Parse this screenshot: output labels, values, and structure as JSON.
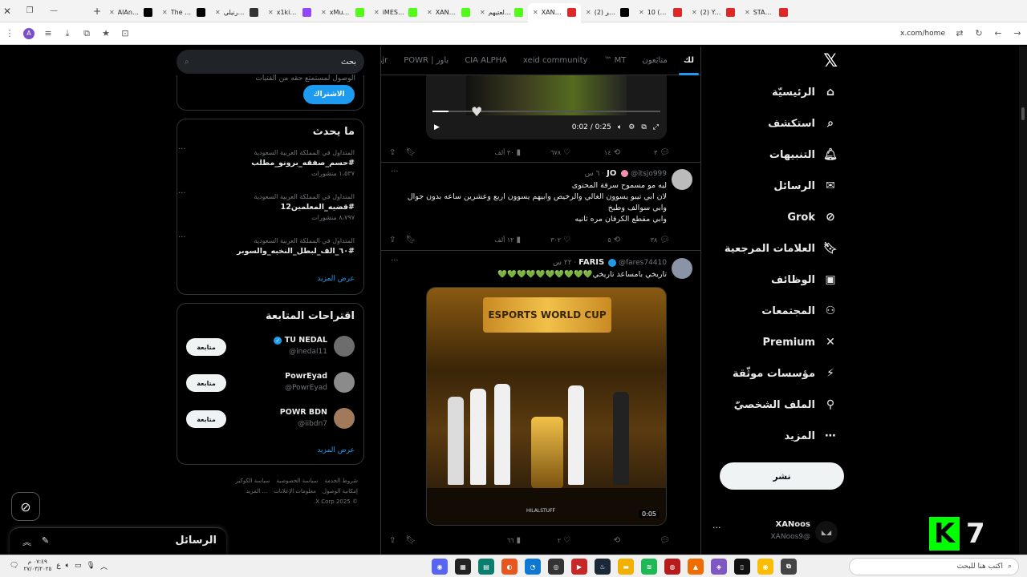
{
  "browser": {
    "tabs": [
      {
        "title": "AlAnzi (@",
        "color": "#000000",
        "icon": "x-icon"
      },
      {
        "title": "The best ",
        "color": "#000000",
        "icon": "tiktok-icon"
      },
      {
        "title": "تورنيلي -",
        "color": "#333333",
        "icon": "github-icon"
      },
      {
        "title": "x1kid Stre",
        "color": "#9146ff",
        "icon": "twitch-icon"
      },
      {
        "title": "xMusaad",
        "color": "#53fc18",
        "icon": "kick-icon"
      },
      {
        "title": "iMESO Str",
        "color": "#53fc18",
        "icon": "kick-icon"
      },
      {
        "title": "XANoos",
        "color": "#53fc18",
        "icon": "kick-icon"
      },
      {
        "title": "لعتيهم | pp",
        "color": "#53fc18",
        "icon": "kick-icon"
      },
      {
        "title": "XANoos (",
        "color": "#e02727",
        "icon": "youtube-icon",
        "active": true
      },
      {
        "title": "(2) لأول مر",
        "color": "#000000",
        "icon": "x-icon"
      },
      {
        "title": "10 (2) دقا",
        "color": "#e02727",
        "icon": "youtube-icon"
      },
      {
        "title": "(2) YouTub",
        "color": "#e02727",
        "icon": "youtube-icon"
      },
      {
        "title": "STARDOM",
        "color": "#e02727",
        "icon": "youtube-icon"
      }
    ],
    "url": "x.com/home",
    "profile_letter": "A"
  },
  "nav": {
    "items": [
      {
        "label": "الرئيسيّة",
        "icon": "⌂",
        "name": "home"
      },
      {
        "label": "استكشف",
        "icon": "⌕",
        "name": "explore"
      },
      {
        "label": "التنبيهات",
        "icon": "🔔︎",
        "name": "notifications"
      },
      {
        "label": "الرسائل",
        "icon": "✉",
        "name": "messages"
      },
      {
        "label": "Grok",
        "icon": "⊘",
        "name": "grok"
      },
      {
        "label": "العلامات المرجعية",
        "icon": "🔖︎",
        "name": "bookmarks"
      },
      {
        "label": "الوظائف",
        "icon": "▣",
        "name": "jobs"
      },
      {
        "label": "المجتمعات",
        "icon": "⚇",
        "name": "communities"
      },
      {
        "label": "Premium",
        "icon": "✕",
        "name": "premium"
      },
      {
        "label": "مؤسسات موثّقة",
        "icon": "⚡",
        "name": "verified-orgs"
      },
      {
        "label": "الملف الشخصيّ",
        "icon": "⚲",
        "name": "profile"
      },
      {
        "label": "المزيد",
        "icon": "⋯",
        "name": "more"
      }
    ],
    "post_label": "نشر",
    "me_name": "XANoos",
    "me_handle": "@XANoos9"
  },
  "overlay": {
    "badge_number": "7"
  },
  "feed": {
    "tabs": [
      "لك",
      "متابَعون",
      "MT ™",
      "xeid community",
      "CIA ALPHA",
      "باور | POWR",
      "Ajr"
    ],
    "video1": {
      "time": "0:02 / 0:25"
    },
    "tweet0_actions": {
      "replies": "٣",
      "reposts": "١٤",
      "likes": "٦٧٨",
      "views": "٣٠ ألف"
    },
    "tweet1": {
      "name": "JO",
      "handle": "@itsjo999",
      "time": "٦ س",
      "lines": [
        "ليه مو مسموح سرقة المحتوى",
        "لان ابي تيبو يسوون الغالي والرخيص وابيهم يسوون اربع وعشرين ساعه بدون جوال",
        "وابي سوالف وطبخ",
        "وابي مقطع الكرفان مره ثانيه"
      ],
      "actions": {
        "replies": "٣٨",
        "reposts": "٥",
        "likes": "٣٠٢",
        "views": "١٢ ألف"
      }
    },
    "tweet2": {
      "name": "FARIS",
      "handle": "@fares74410",
      "time": "٢٢ س",
      "text": "تاريخي بامساعد تاريخي💚💚💚💚💚💚💚💚💚💚",
      "media_logo": "ESPORTS WORLD CUP",
      "watermark": "HILALSTUFF",
      "duration": "0:05",
      "actions": {
        "replies": "",
        "reposts": "",
        "likes": "٢",
        "views": "٦٦"
      }
    }
  },
  "sidebar": {
    "search_placeholder": "بحث",
    "premium_cut_text": "الوصول لمستمتع حقه من الفتيات",
    "subscribe_label": "الاشتراك",
    "trends_title": "ما يحدث",
    "trends": [
      {
        "context": "المتداول في المملكة العربية السعودية",
        "tag": "#حسم_صفقه_برونو_مطلب",
        "count": "١،٥٣٧ منشورات"
      },
      {
        "context": "المتداول في المملكة العربية السعودية",
        "tag": "#قضيه_المعلمين12",
        "count": "٨،٧٩٧ منشورات"
      },
      {
        "context": "المتداول في المملكة العربية السعودية",
        "tag": "#٦٠_الف_لبطل_النخبه_والسوبر",
        "count": ""
      }
    ],
    "show_more": "عرض المزيد",
    "follow_title": "اقتراحات المتابعة",
    "follow_button": "متابعة",
    "follow": [
      {
        "name": "TU NEDAL",
        "handle": "@inedal11",
        "verified": true
      },
      {
        "name": "PowrEyad",
        "handle": "@PowrEyad",
        "verified": false
      },
      {
        "name": "POWR BDN",
        "handle": "@iibdn7",
        "verified": false
      }
    ],
    "footer": [
      "شروط الخدمة",
      "سياسة الخصوصية",
      "سياسة الكوكيز",
      "إمكانية الوصول",
      "معلومات الإعلانات",
      "... المزيد",
      "© 2025 X Corp."
    ]
  },
  "messages_bar": {
    "title": "الرسائل"
  },
  "taskbar": {
    "search_placeholder": "اكتب هنا للبحث",
    "time": "٠٧:٤٩ م",
    "date": "٢٧/٠٣/٢٠٢٥",
    "lang": "ع"
  }
}
